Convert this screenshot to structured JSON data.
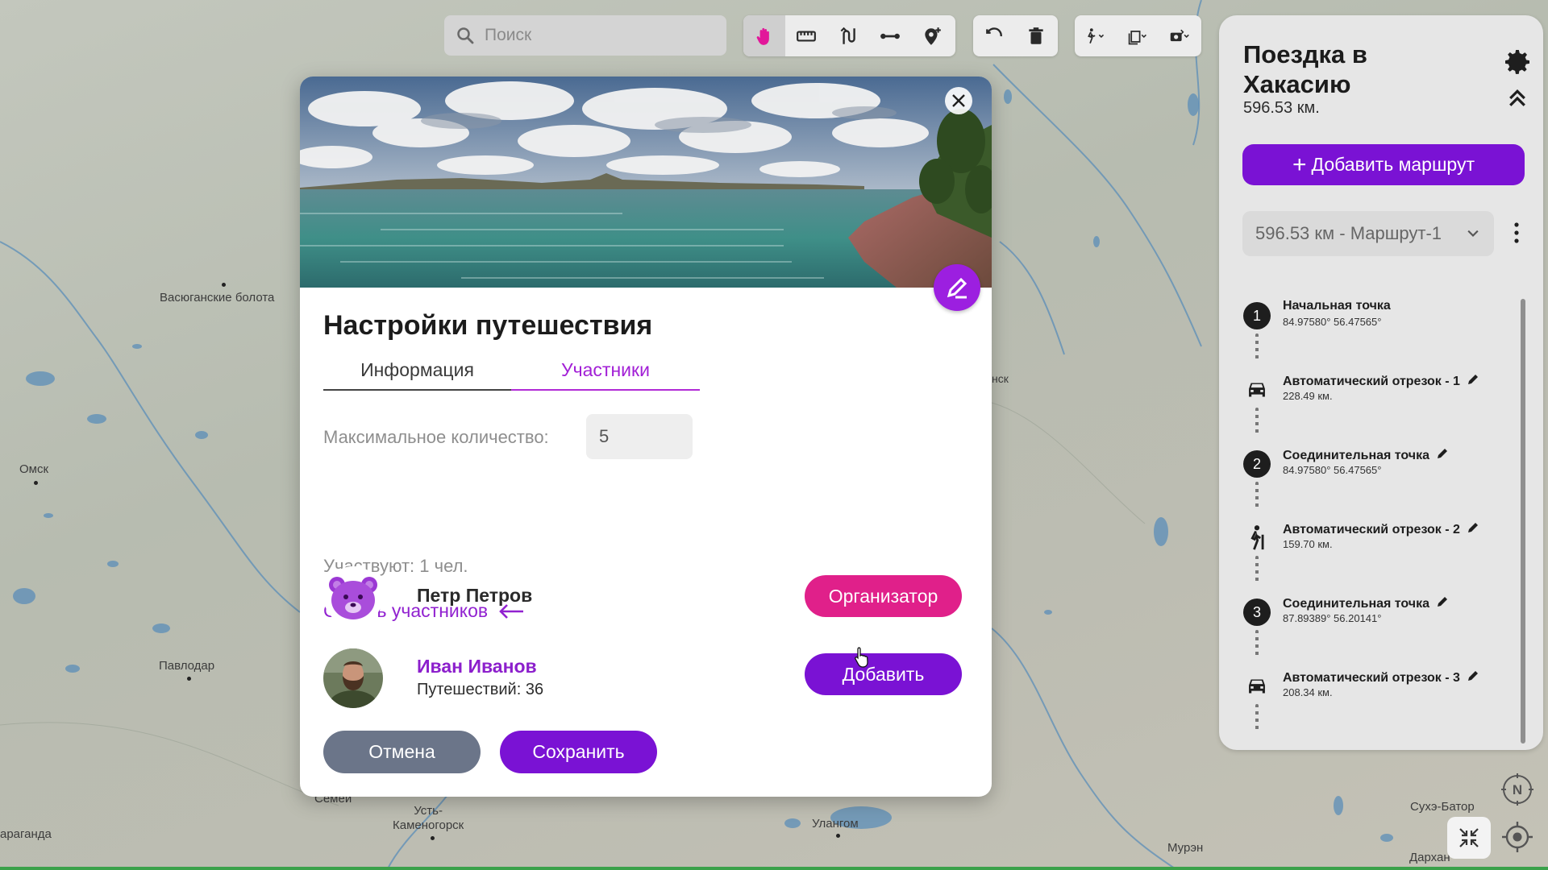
{
  "map": {
    "cities": [
      {
        "id": "vasyugan",
        "label": "Васюганские болота"
      },
      {
        "id": "omsk",
        "label": "Омск"
      },
      {
        "id": "pavlodar",
        "label": "Павлодар"
      },
      {
        "id": "ust-kam",
        "label": "Усть-\nКаменогорск"
      },
      {
        "id": "ulangom",
        "label": "Улангом"
      },
      {
        "id": "sukhbaatar",
        "label": "Сухэ-Батор"
      },
      {
        "id": "murun",
        "label": "Мурэн"
      },
      {
        "id": "darkhan",
        "label": "Дархан"
      },
      {
        "id": "karaganda",
        "label": "араганда"
      },
      {
        "id": "semey",
        "label": "Семей"
      },
      {
        "id": "nsk",
        "label": "нск"
      }
    ]
  },
  "toolbar": {
    "search_placeholder": "Поиск",
    "tools": [
      {
        "id": "pan",
        "icon": "hand-icon",
        "active": true
      },
      {
        "id": "ruler",
        "icon": "ruler-icon"
      },
      {
        "id": "route",
        "icon": "route-icon"
      },
      {
        "id": "segment",
        "icon": "segment-icon"
      },
      {
        "id": "add-point",
        "icon": "add-pin-icon"
      },
      {
        "id": "undo",
        "icon": "undo-icon"
      },
      {
        "id": "delete",
        "icon": "trash-icon"
      },
      {
        "id": "transport",
        "icon": "walker-icon"
      },
      {
        "id": "layers",
        "icon": "layers-icon"
      },
      {
        "id": "photo",
        "icon": "camera-icon"
      }
    ]
  },
  "panel": {
    "title": "Поездка в Хакасию",
    "distance": "596.53 км.",
    "add_route_label": "Добавить маршрут",
    "route_selected": "596.53 км - Маршрут-1",
    "steps": [
      {
        "type": "point",
        "number": "1",
        "name": "Начальная точка",
        "sub": "84.97580° 56.47565°",
        "editable": false
      },
      {
        "type": "car",
        "name": "Автоматический отрезок - 1",
        "sub": "228.49 км.",
        "editable": true
      },
      {
        "type": "point",
        "number": "2",
        "name": "Соединительная точка",
        "sub": "84.97580° 56.47565°",
        "editable": true
      },
      {
        "type": "walk",
        "name": "Автоматический отрезок - 2",
        "sub": "159.70 км.",
        "editable": true
      },
      {
        "type": "point",
        "number": "3",
        "name": "Соединительная точка",
        "sub": "87.89389° 56.20141°",
        "editable": true
      },
      {
        "type": "car",
        "name": "Автоматический отрезок - 3",
        "sub": "208.34 км.",
        "editable": true
      }
    ]
  },
  "modal": {
    "title": "Настройки путешествия",
    "tabs": {
      "info": "Информация",
      "members": "Участники"
    },
    "active_tab": "members",
    "max_label": "Максимальное количество:",
    "max_value": "5",
    "participants_text": "Участвуют: 1 чел.",
    "hide_members_label": "Скрыть участников",
    "members": [
      {
        "name": "Петр Петров",
        "trips": "",
        "action": "Организатор",
        "avatar": "bear"
      },
      {
        "name": "Иван Иванов",
        "trips": "Путешествий: 36",
        "action": "Добавить",
        "avatar": "photo"
      }
    ],
    "cancel_label": "Отмена",
    "save_label": "Сохранить"
  },
  "colors": {
    "accent": "#7a12d4",
    "magenta": "#e0208a",
    "link": "#9121d0",
    "cancel": "#6b7589",
    "panel_bg": "#e6e6e6"
  }
}
